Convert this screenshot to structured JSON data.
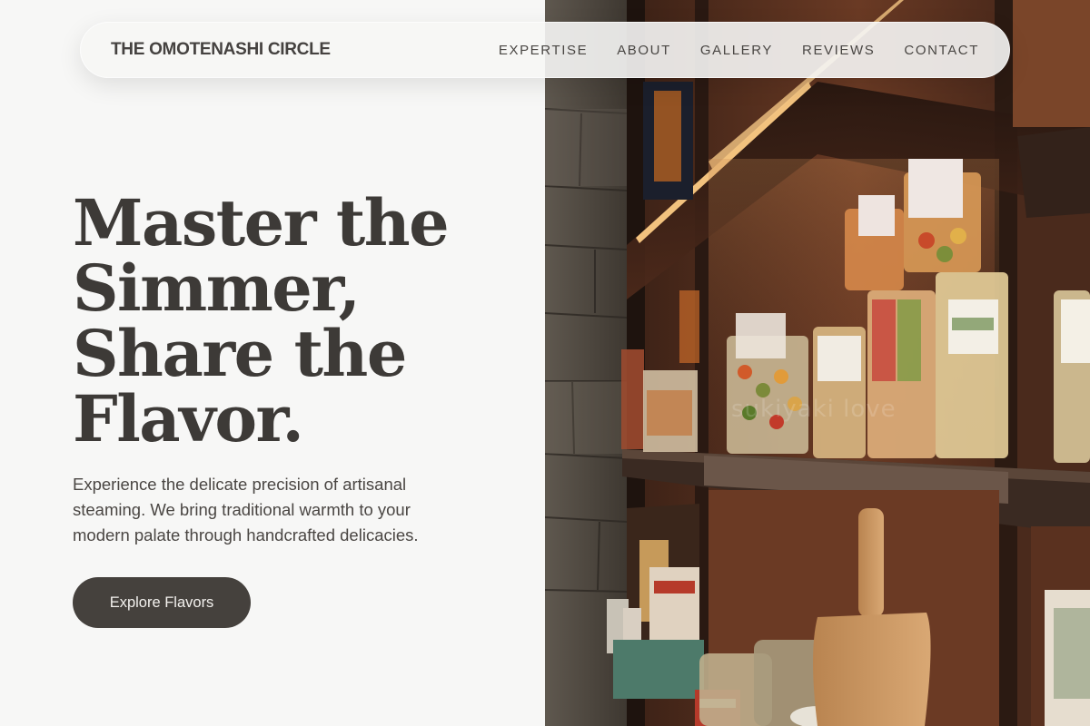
{
  "nav": {
    "brand": "THE OMOTENASHI CIRCLE",
    "links": [
      "EXPERTISE",
      "ABOUT",
      "GALLERY",
      "REVIEWS",
      "CONTACT"
    ]
  },
  "hero": {
    "headline_lines": [
      "Master the",
      "Simmer,",
      "Share the",
      "Flavor."
    ],
    "description": "Experience the delicate precision of artisanal steaming. We bring traditional warmth to your modern palate through handcrafted delicacies.",
    "cta_label": "Explore Flavors"
  },
  "photo": {
    "subject": "pasta-shelves-photo",
    "watermark": "sukiyaki love"
  },
  "colors": {
    "background": "#f7f7f6",
    "text": "#3d3a37",
    "button": "#45413d",
    "button_text": "#f3f1ee"
  }
}
